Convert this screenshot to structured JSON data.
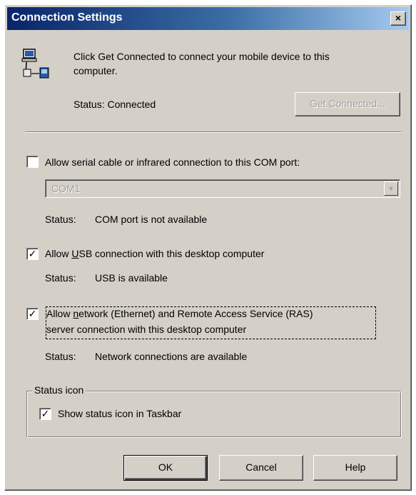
{
  "window": {
    "title": "Connection Settings",
    "close_glyph": "×"
  },
  "intro": {
    "line1": "Click Get Connected to connect your mobile device to this",
    "line2": "computer.",
    "status_text": "Status: Connected",
    "get_connected_label": "Get Connected..."
  },
  "serial": {
    "checked": false,
    "label": "Allow serial cable or infrared connection to this COM port:",
    "port_value": "COM1",
    "status_label": "Status:",
    "status_value": "COM port is not available"
  },
  "usb": {
    "checked": true,
    "label_pre": "Allow ",
    "label_ul": "U",
    "label_post": "SB connection with this desktop computer",
    "status_label": "Status:",
    "status_value": "USB is available"
  },
  "network": {
    "checked": true,
    "label_pre": "Allow ",
    "label_ul": "n",
    "label_post": "etwork (Ethernet) and Remote Access Service (RAS)",
    "label_line2": "server connection with this desktop computer",
    "status_label": "Status:",
    "status_value": "Network connections are available"
  },
  "status_icon_group": {
    "legend": "Status icon",
    "checked": true,
    "label": "Show status icon in Taskbar"
  },
  "buttons": {
    "ok": "OK",
    "cancel": "Cancel",
    "help": "Help"
  },
  "check_glyph": "✓",
  "combo_arrow_glyph": "▼",
  "icons": {
    "intro": "computer-device-connection-icon"
  }
}
